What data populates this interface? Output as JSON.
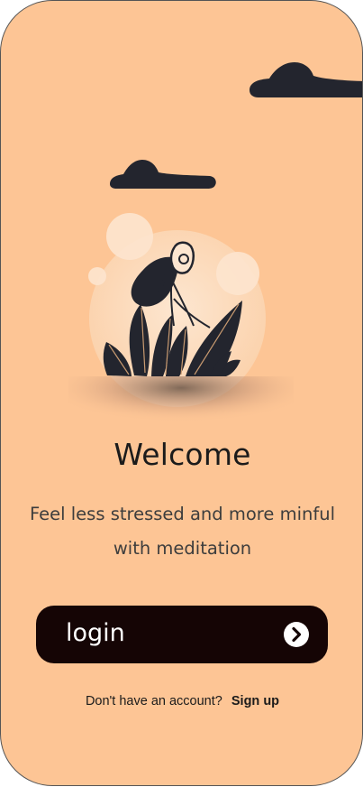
{
  "welcome": {
    "title": "Welcome",
    "subtitle": "Feel less stressed and more minful with meditation"
  },
  "login_button": {
    "label": "login",
    "icon": "chevron-right-circle-icon"
  },
  "signup": {
    "prompt": "Don't have an account?",
    "link": "Sign up"
  },
  "colors": {
    "background": "#fdc595",
    "button": "#150505",
    "clouds": "#23252e"
  }
}
